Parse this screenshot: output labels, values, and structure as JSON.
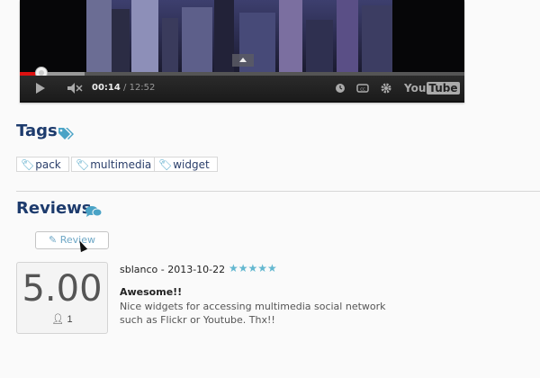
{
  "player": {
    "time_current": "00:14",
    "time_separator": " / ",
    "time_total": "12:52",
    "progress_fraction": 0.018,
    "buffered_fraction": 0.08,
    "brand_text": "You",
    "brand_badge": "Tube",
    "icons": [
      "play-icon",
      "volume-mute-icon",
      "clock-icon",
      "captions-icon",
      "settings-gear-icon",
      "youtube-logo",
      "fullscreen-icon",
      "seek-up-arrow-icon"
    ]
  },
  "tags": {
    "title": "Tags",
    "items": [
      {
        "label": "pack"
      },
      {
        "label": "multimedia"
      },
      {
        "label": "widget"
      }
    ]
  },
  "reviews": {
    "title": "Reviews",
    "review_button": "Review",
    "score": "5.00",
    "count": "1",
    "items": [
      {
        "meta": "sblanco - 2013-10-22",
        "stars": "★★★★★",
        "title": "Awesome!!",
        "body": "Nice widgets for accessing multimedia social network such as Flickr or Youtube. Thx!!"
      }
    ]
  },
  "colors": {
    "heading": "#1d3b6d",
    "accent": "#4aa3c6",
    "stars": "#64b8d0",
    "progress": "#dd1111"
  }
}
